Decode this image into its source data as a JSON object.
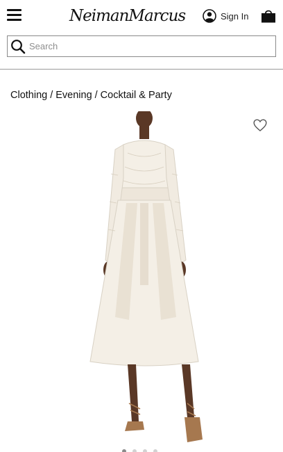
{
  "header": {
    "brand": "NeimanMarcus",
    "signin_label": "Sign In"
  },
  "search": {
    "placeholder": "Search",
    "value": ""
  },
  "breadcrumb": {
    "items": [
      "Clothing",
      "Evening",
      "Cocktail & Party"
    ],
    "separator": "/"
  },
  "carousel": {
    "total": 4,
    "active_index": 1
  },
  "icons": {
    "menu": "hamburger-menu-icon",
    "account": "user-circle-icon",
    "bag": "shopping-bag-icon",
    "search": "magnifier-icon",
    "favorite": "heart-outline-icon"
  },
  "colors": {
    "text": "#111111",
    "border": "#8a8a8a",
    "dress": "#f4efe6",
    "skin": "#5a3826"
  }
}
